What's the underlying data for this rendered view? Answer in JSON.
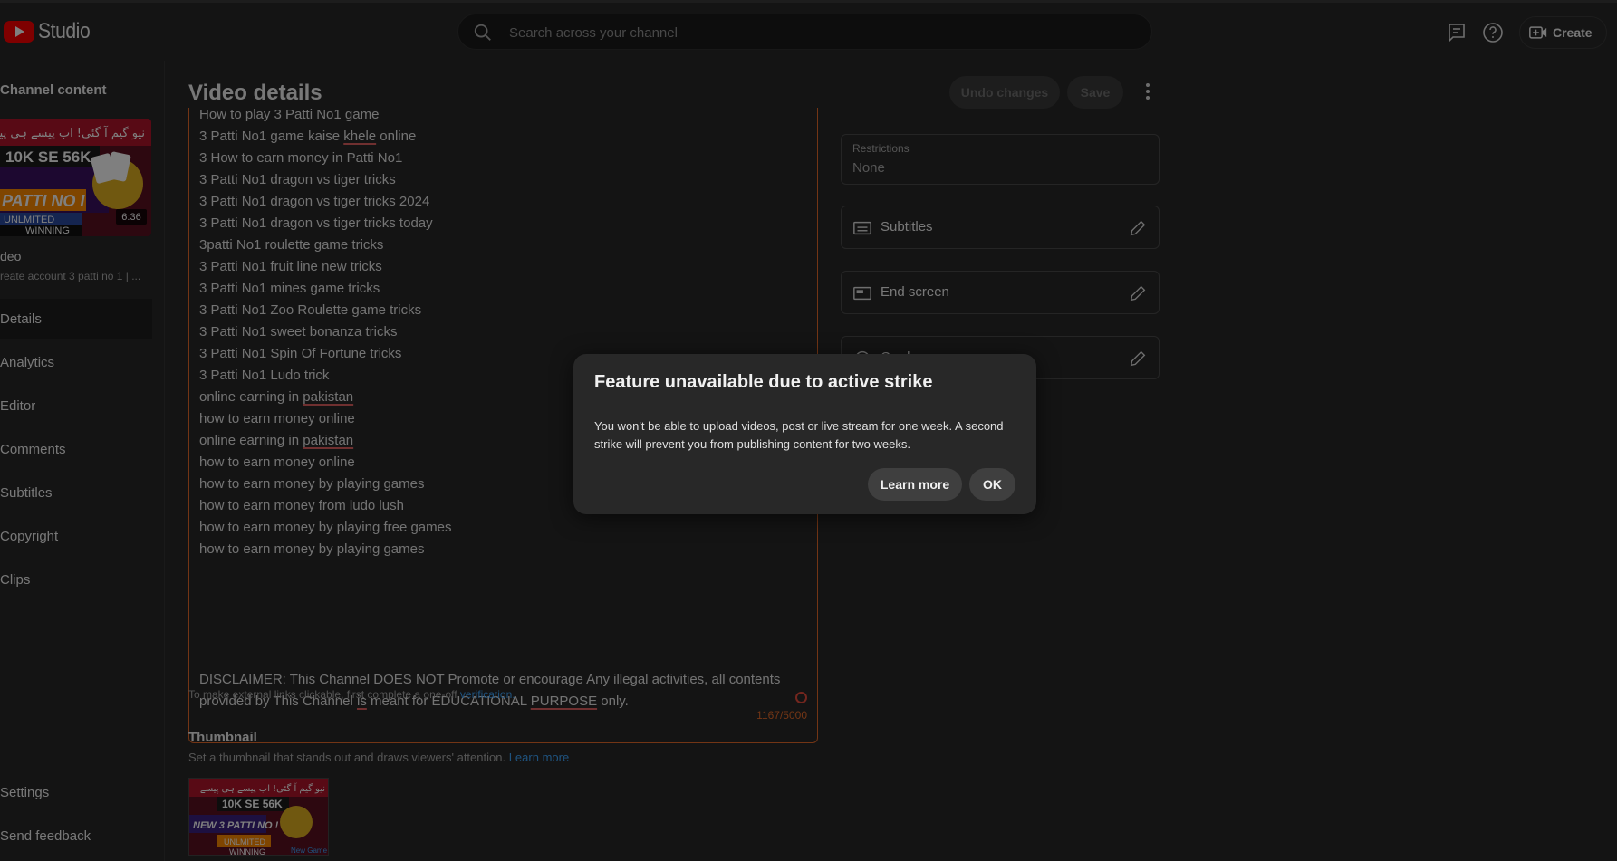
{
  "header": {
    "logo_text": "Studio",
    "search_placeholder": "Search across your channel",
    "create_label": "Create"
  },
  "sidebar": {
    "title": "Channel content",
    "thumb_duration": "6:36",
    "video_title": "deo",
    "video_desc": "reate account 3 patti no 1 | ...",
    "items": [
      {
        "label": "Details"
      },
      {
        "label": "Analytics"
      },
      {
        "label": "Editor"
      },
      {
        "label": "Comments"
      },
      {
        "label": "Subtitles"
      },
      {
        "label": "Copyright"
      },
      {
        "label": "Clips"
      }
    ],
    "settings_label": "Settings",
    "feedback_label": "Send feedback"
  },
  "thumbnail_art": {
    "urdu_banner": "نیو گیم آ گئی! اب پیسے ہی پیسے",
    "headline": "10K SE 56K",
    "brand": "PATTI NO I",
    "brand_small": "NEW 3 PATTI NO !",
    "unlimited": "UNLMITED",
    "winning": "WINNING",
    "new_game": "New Game"
  },
  "main": {
    "title": "Video details",
    "undo_label": "Undo changes",
    "save_label": "Save",
    "description_lines": [
      "How to play 3 Patti No1 game",
      "3 Patti No1 game kaise |khele| online",
      "3 How to earn money in Patti No1",
      "3 Patti No1 dragon vs tiger tricks",
      "3 Patti No1 dragon vs tiger tricks 2024",
      "3 Patti No1 dragon vs tiger tricks today",
      "3patti No1 roulette game tricks",
      "3 Patti No1 fruit line new tricks",
      "3 Patti No1 mines game tricks",
      "3 Patti No1 Zoo Roulette game tricks",
      "3 Patti No1 sweet bonanza tricks",
      "3 Patti No1 Spin Of Fortune tricks",
      "3 Patti No1 Ludo trick",
      "online earning in |pakistan|",
      "how to earn money online",
      "online earning in |pakistan|",
      "how to earn money online",
      "how to earn money by playing games",
      "how to earn money from ludo lush",
      "how to earn money by playing free games",
      "how to earn money by playing games"
    ],
    "disclaimer_line1": "DISCLAIMER: This Channel DOES NOT Promote or encourage Any illegal activities, all contents",
    "disclaimer_line2": "provided by This Channel |is| meant for EDUCATIONAL |PURPOSE| only.",
    "char_counter": "1167/5000",
    "links_note": "To make external links clickable, first complete a one-off",
    "links_note_link": "verification.",
    "thumbnail_title": "Thumbnail",
    "thumbnail_sub": "Set a thumbnail that stands out and draws viewers' attention.",
    "thumbnail_learn_more": "Learn more"
  },
  "right_panel": {
    "restrictions_label": "Restrictions",
    "restrictions_value": "None",
    "subtitles_label": "Subtitles",
    "end_screen_label": "End screen",
    "cards_label": "Cards"
  },
  "dialog": {
    "title": "Feature unavailable due to active strike",
    "body": "You won't be able to upload videos, post or live stream for one week. A second strike will prevent you from publishing content for two weeks.",
    "learn_more_label": "Learn more",
    "ok_label": "OK"
  },
  "colors": {
    "accent_red": "#ff0000",
    "error_orange": "#e66b2b",
    "link_blue": "#3ea6ff",
    "background": "#282828"
  }
}
